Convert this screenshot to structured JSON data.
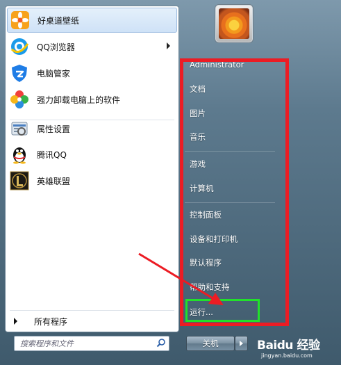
{
  "programs": [
    {
      "label": "好桌道壁纸",
      "icon": "orange-flower-icon",
      "selected": true
    },
    {
      "label": "QQ浏览器",
      "icon": "qq-browser-icon",
      "submenu": true
    },
    {
      "label": "电脑管家",
      "icon": "shield-icon"
    },
    {
      "label": "强力卸载电脑上的软件",
      "icon": "colorful-clover-icon"
    },
    {
      "label": "属性设置",
      "icon": "settings-tool-icon"
    },
    {
      "label": "腾讯QQ",
      "icon": "penguin-icon"
    },
    {
      "label": "英雄联盟",
      "icon": "league-l-icon"
    }
  ],
  "all_programs": "所有程序",
  "search": {
    "placeholder": "搜索程序和文件"
  },
  "right_items": [
    {
      "label": "Administrator"
    },
    {
      "label": "文档"
    },
    {
      "label": "图片"
    },
    {
      "label": "音乐"
    },
    {
      "label": "游戏"
    },
    {
      "label": "计算机"
    },
    {
      "label": "控制面板"
    },
    {
      "label": "设备和打印机"
    },
    {
      "label": "默认程序"
    },
    {
      "label": "帮助和支持"
    },
    {
      "label": "运行..."
    }
  ],
  "shutdown": {
    "label": "关机"
  },
  "watermark": {
    "brand": "Baidu 经验",
    "url": "jingyan.baidu.com"
  },
  "colors": {
    "highlight_box": "#ec1c24",
    "target_box": "#21e12a",
    "accent": "#cfe2f7"
  }
}
